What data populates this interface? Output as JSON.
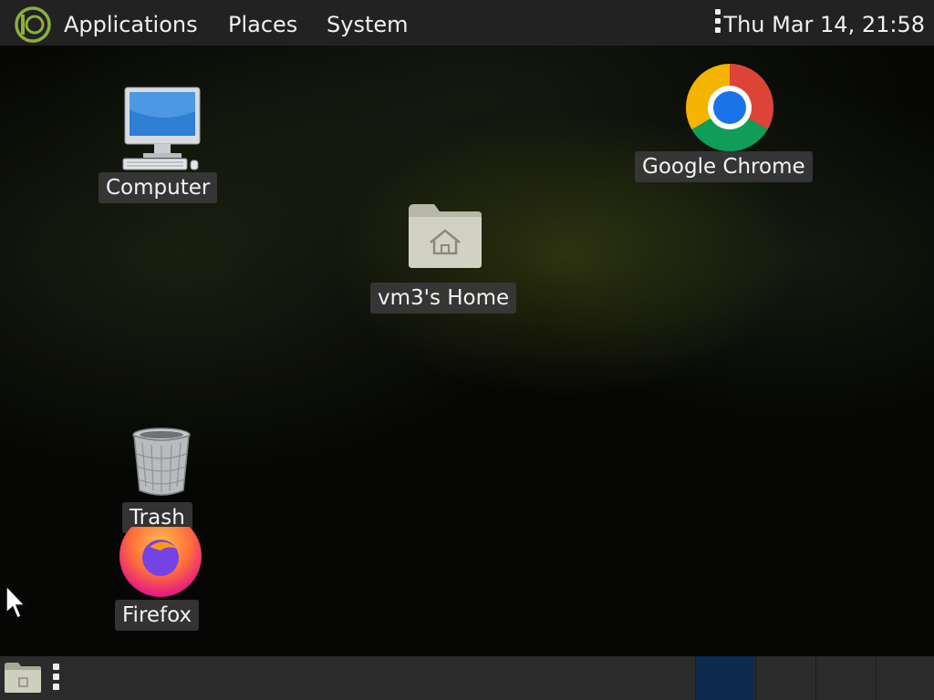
{
  "top_panel": {
    "menus": [
      {
        "label": "Applications"
      },
      {
        "label": "Places"
      },
      {
        "label": "System"
      }
    ],
    "clock": "Thu Mar 14, 21:58",
    "menu_logo_icon": "mate-logo-icon",
    "handle_icon": "panel-handle-icon"
  },
  "desktop": {
    "icons": [
      {
        "label": "Computer",
        "icon": "computer-icon"
      },
      {
        "label": "vm3's Home",
        "icon": "home-folder-icon"
      },
      {
        "label": "Google Chrome",
        "icon": "chrome-icon"
      },
      {
        "label": "Trash",
        "icon": "trash-icon"
      },
      {
        "label": "Firefox",
        "icon": "firefox-icon"
      }
    ]
  },
  "bottom_panel": {
    "show_desktop_icon": "show-desktop-icon",
    "workspaces": [
      {
        "active": true,
        "color": "#0d2a4e"
      },
      {
        "active": false
      },
      {
        "active": false
      },
      {
        "active": false
      }
    ]
  },
  "colors": {
    "panel_bg": "#222222",
    "bottom_panel_bg": "#2b2b2b",
    "active_workspace": "#0d2a4e",
    "logo_green": "#8ab03a"
  }
}
